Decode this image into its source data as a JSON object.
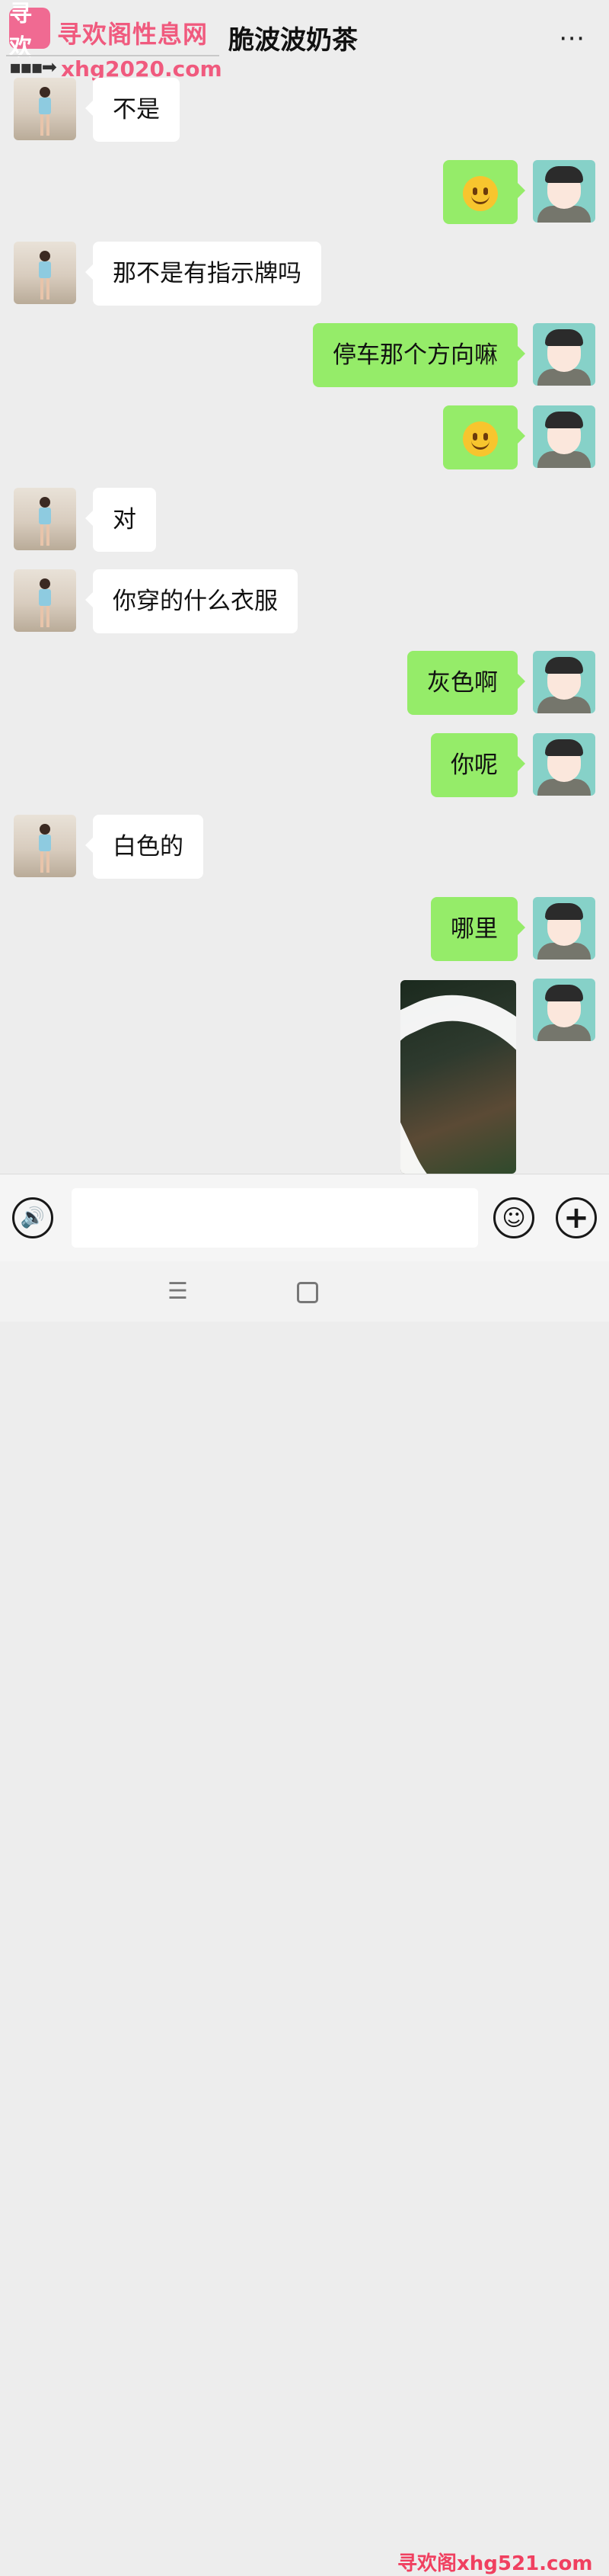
{
  "header": {
    "watermark_logo": "寻欢",
    "watermark_title": "寻欢阁性息网",
    "watermark_arrow": "▪▪▪➡",
    "watermark_url": "xhg2020.com",
    "chat_title": "脆波波奶茶",
    "more_icon": "⋯"
  },
  "messages": [
    {
      "side": "left",
      "text": "不是"
    },
    {
      "side": "right",
      "text": "",
      "emoji": "smile-emoji"
    },
    {
      "side": "left",
      "text": "那不是有指示牌吗"
    },
    {
      "side": "right",
      "text": "停车那个方向嘛"
    },
    {
      "side": "right",
      "text": "",
      "emoji": "smile-emoji"
    },
    {
      "side": "left",
      "text": "对"
    },
    {
      "side": "left",
      "text": "你穿的什么衣服"
    },
    {
      "side": "right",
      "text": "灰色啊"
    },
    {
      "side": "right",
      "text": "你呢"
    },
    {
      "side": "left",
      "text": "白色的"
    },
    {
      "side": "right",
      "text": "哪里"
    },
    {
      "side": "right",
      "image": "photo-scribbled"
    }
  ],
  "input_bar": {
    "voice_icon": "🔊",
    "emoji_icon": "☺",
    "plus_icon": "+",
    "input_value": ""
  },
  "nav_bar": {
    "menu_icon": "☰",
    "home_icon": "square-icon",
    "watermark_bottom": "寻欢阁xhg521.com"
  },
  "colors": {
    "background": "#ededed",
    "bubble_self": "#95ec69",
    "bubble_other": "#ffffff",
    "watermark": "#f05a7e"
  }
}
